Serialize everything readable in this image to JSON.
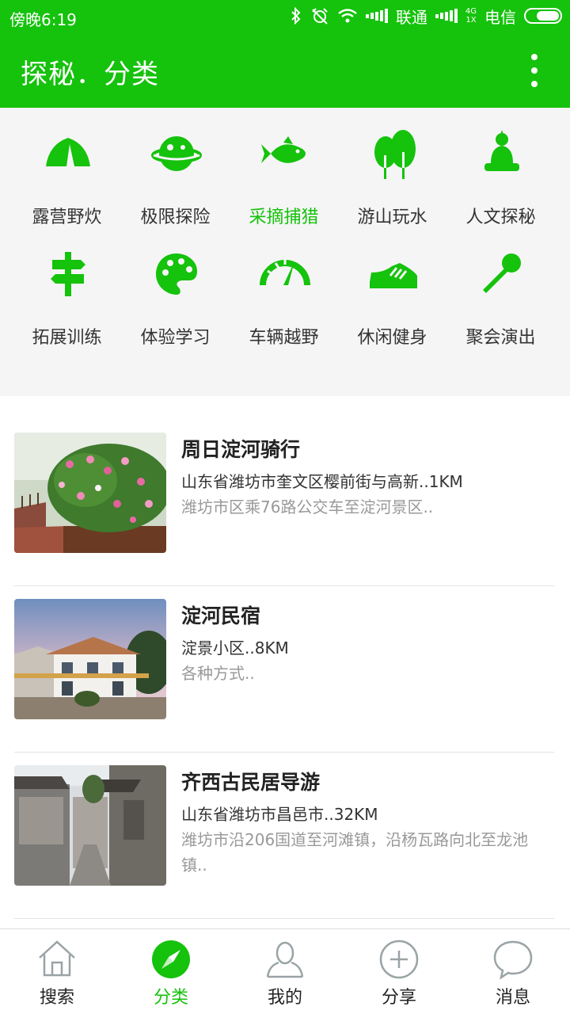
{
  "status_bar": {
    "time": "傍晚6:19",
    "carrier1": "联通",
    "carrier2": "电信",
    "network_top": "4G",
    "network_bottom": "1X",
    "icons": [
      "bluetooth-icon",
      "alarm-off-icon",
      "wifi-icon",
      "signal-icon",
      "signal-icon",
      "battery-icon"
    ]
  },
  "app_bar": {
    "title": "探秘．分类",
    "more_icon": "more-vert-icon"
  },
  "categories": [
    {
      "label": "露营野炊",
      "icon": "tent-icon"
    },
    {
      "label": "极限探险",
      "icon": "planet-icon"
    },
    {
      "label": "采摘捕猎",
      "icon": "fish-icon",
      "active": true
    },
    {
      "label": "游山玩水",
      "icon": "trees-icon"
    },
    {
      "label": "人文探秘",
      "icon": "buddha-icon"
    },
    {
      "label": "拓展训练",
      "icon": "signpost-icon"
    },
    {
      "label": "体验学习",
      "icon": "palette-icon"
    },
    {
      "label": "车辆越野",
      "icon": "speedometer-icon"
    },
    {
      "label": "休闲健身",
      "icon": "sneaker-icon"
    },
    {
      "label": "聚会演出",
      "icon": "microphone-icon"
    }
  ],
  "places": [
    {
      "name": "周日淀河骑行",
      "address": "山东省潍坊市奎文区樱前街与高新..1KM",
      "description": "潍坊市区乘76路公交车至淀河景区.."
    },
    {
      "name": "淀河民宿",
      "address": "淀景小区..8KM",
      "description": "各种方式.."
    },
    {
      "name": "齐西古民居导游",
      "address": "山东省潍坊市昌邑市..32KM",
      "description": "潍坊市沿206国道至河滩镇，沿杨瓦路向北至龙池镇.."
    }
  ],
  "tabs": [
    {
      "label": "搜索",
      "icon": "home-icon"
    },
    {
      "label": "分类",
      "icon": "compass-icon",
      "active": true
    },
    {
      "label": "我的",
      "icon": "person-icon"
    },
    {
      "label": "分享",
      "icon": "add-circle-icon"
    },
    {
      "label": "消息",
      "icon": "chat-bubble-icon"
    }
  ],
  "colors": {
    "accent": "#15c20c",
    "grid_bg": "#f5f5f5",
    "desc_text": "#999999"
  }
}
